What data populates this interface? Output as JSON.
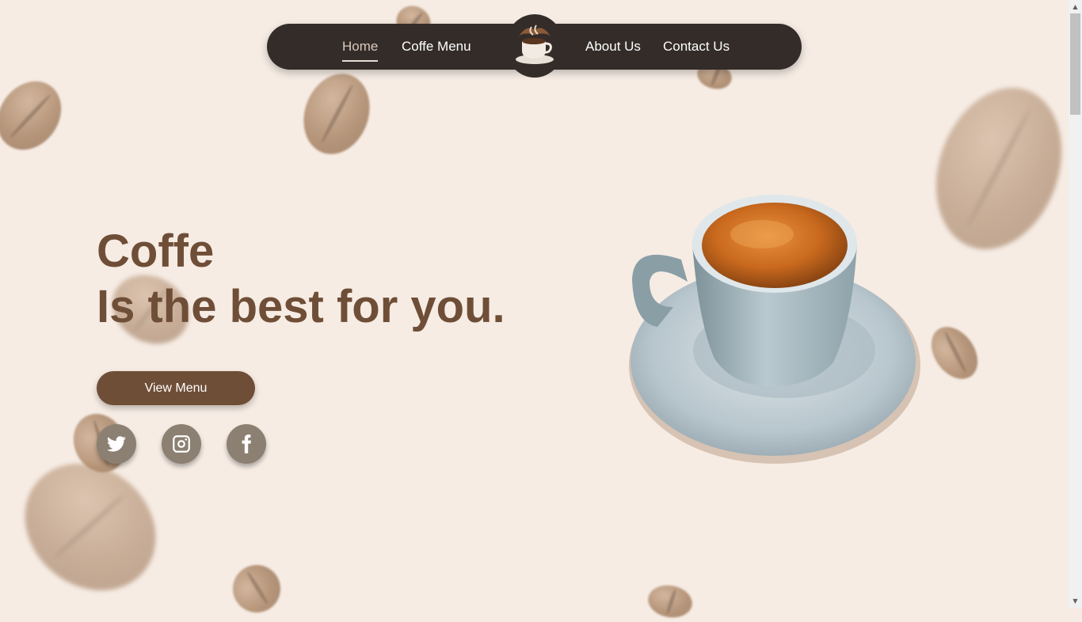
{
  "nav": {
    "links": [
      {
        "label": "Home",
        "active": true
      },
      {
        "label": "Coffe Menu"
      },
      {
        "label": "About Us"
      },
      {
        "label": "Contact Us"
      }
    ],
    "logo_icon": "coffee-cup-logo-icon"
  },
  "hero": {
    "title_line1": "Coffe",
    "title_line2": "Is the best for you.",
    "button_label": "View Menu",
    "social": [
      "twitter-icon",
      "instagram-icon",
      "facebook-icon"
    ]
  },
  "colors": {
    "background": "#f6ece4",
    "nav": "#332c29",
    "accent": "#6f4e37",
    "social": "#8c8072"
  }
}
